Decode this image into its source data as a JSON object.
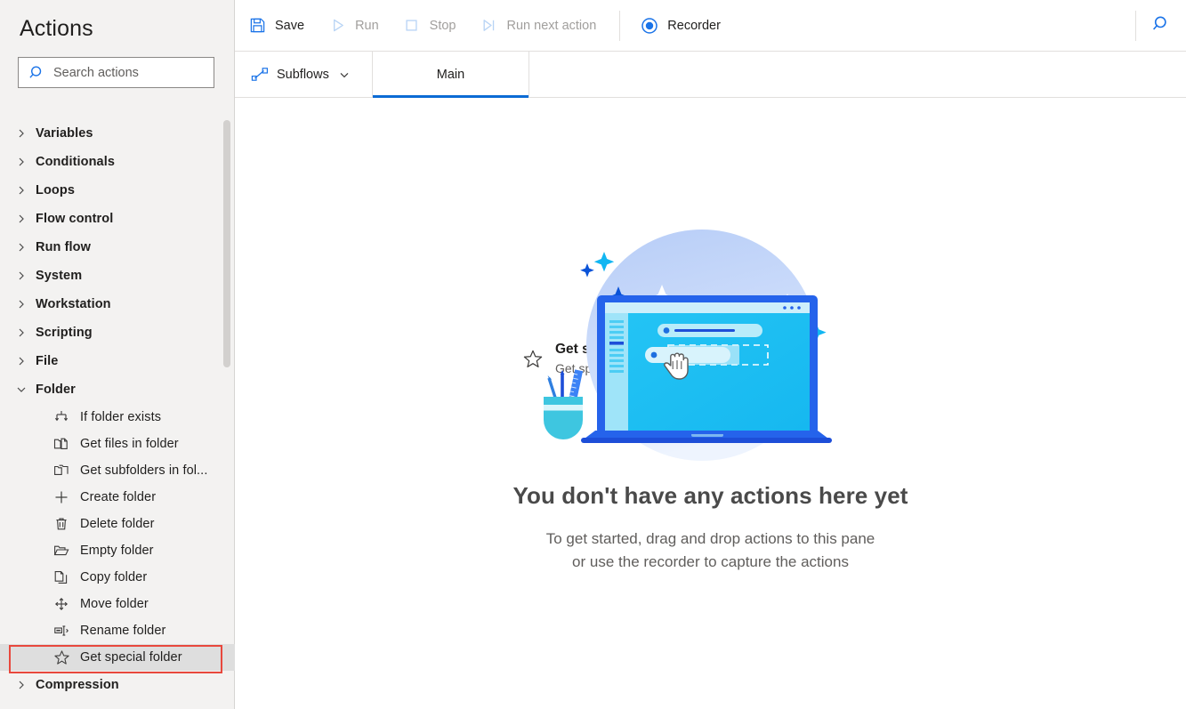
{
  "sidebar": {
    "title": "Actions",
    "search": {
      "placeholder": "Search actions",
      "value": "",
      "icon": "search-icon"
    },
    "groups": [
      {
        "label": "Variables",
        "expanded": false,
        "icon": "chevron-right-icon"
      },
      {
        "label": "Conditionals",
        "expanded": false,
        "icon": "chevron-right-icon"
      },
      {
        "label": "Loops",
        "expanded": false,
        "icon": "chevron-right-icon"
      },
      {
        "label": "Flow control",
        "expanded": false,
        "icon": "chevron-right-icon"
      },
      {
        "label": "Run flow",
        "expanded": false,
        "icon": "chevron-right-icon"
      },
      {
        "label": "System",
        "expanded": false,
        "icon": "chevron-right-icon"
      },
      {
        "label": "Workstation",
        "expanded": false,
        "icon": "chevron-right-icon"
      },
      {
        "label": "Scripting",
        "expanded": false,
        "icon": "chevron-right-icon"
      },
      {
        "label": "File",
        "expanded": false,
        "icon": "chevron-right-icon"
      },
      {
        "label": "Folder",
        "expanded": true,
        "icon": "chevron-down-icon"
      }
    ],
    "folder_actions": [
      {
        "label": "If folder exists",
        "icon": "branch-arrows-icon",
        "selected": false
      },
      {
        "label": "Get files in folder",
        "icon": "folder-file-icon",
        "selected": false
      },
      {
        "label": "Get subfolders in fol...",
        "icon": "folders-icon",
        "selected": false
      },
      {
        "label": "Create folder",
        "icon": "plus-icon",
        "selected": false
      },
      {
        "label": "Delete folder",
        "icon": "trash-icon",
        "selected": false
      },
      {
        "label": "Empty folder",
        "icon": "open-folder-icon",
        "selected": false
      },
      {
        "label": "Copy folder",
        "icon": "copy-pages-icon",
        "selected": false
      },
      {
        "label": "Move folder",
        "icon": "move-arrows-icon",
        "selected": false
      },
      {
        "label": "Rename folder",
        "icon": "rename-icon",
        "selected": false
      },
      {
        "label": "Get special folder",
        "icon": "star-icon",
        "selected": true
      }
    ],
    "trailing_group": {
      "label": "Compression",
      "expanded": false,
      "icon": "chevron-right-icon"
    },
    "highlight_color": "#e8483d",
    "scrollbar": {
      "name": "sidebar-scrollbar"
    }
  },
  "toolbar": {
    "buttons": [
      {
        "label": "Save",
        "icon": "save-icon",
        "enabled": true
      },
      {
        "label": "Run",
        "icon": "play-icon",
        "enabled": false
      },
      {
        "label": "Stop",
        "icon": "stop-square-icon",
        "enabled": false
      },
      {
        "label": "Run next action",
        "icon": "step-over-icon",
        "enabled": false
      }
    ],
    "recorder": {
      "label": "Recorder",
      "icon": "record-icon",
      "enabled": true
    },
    "search_icon": "search-icon",
    "accent_color": "#0b6bd4"
  },
  "tabstrip": {
    "subflows": {
      "label": "Subflows",
      "icon": "subflow-graph-icon",
      "chevron": "chevron-down-icon"
    },
    "tabs": [
      {
        "label": "Main",
        "active": true
      }
    ]
  },
  "canvas": {
    "drag_preview": {
      "title": "Get special folder",
      "subtitle": "Get special folder",
      "icon": "star-icon"
    },
    "cursor": {
      "icon": "drag-copy-cursor-icon"
    },
    "empty_state": {
      "illustration": "laptop-drag-drop-illustration",
      "title": "You don't have any actions here yet",
      "line1": "To get started, drag and drop actions to this pane",
      "line2": "or use the recorder to capture the actions"
    }
  }
}
